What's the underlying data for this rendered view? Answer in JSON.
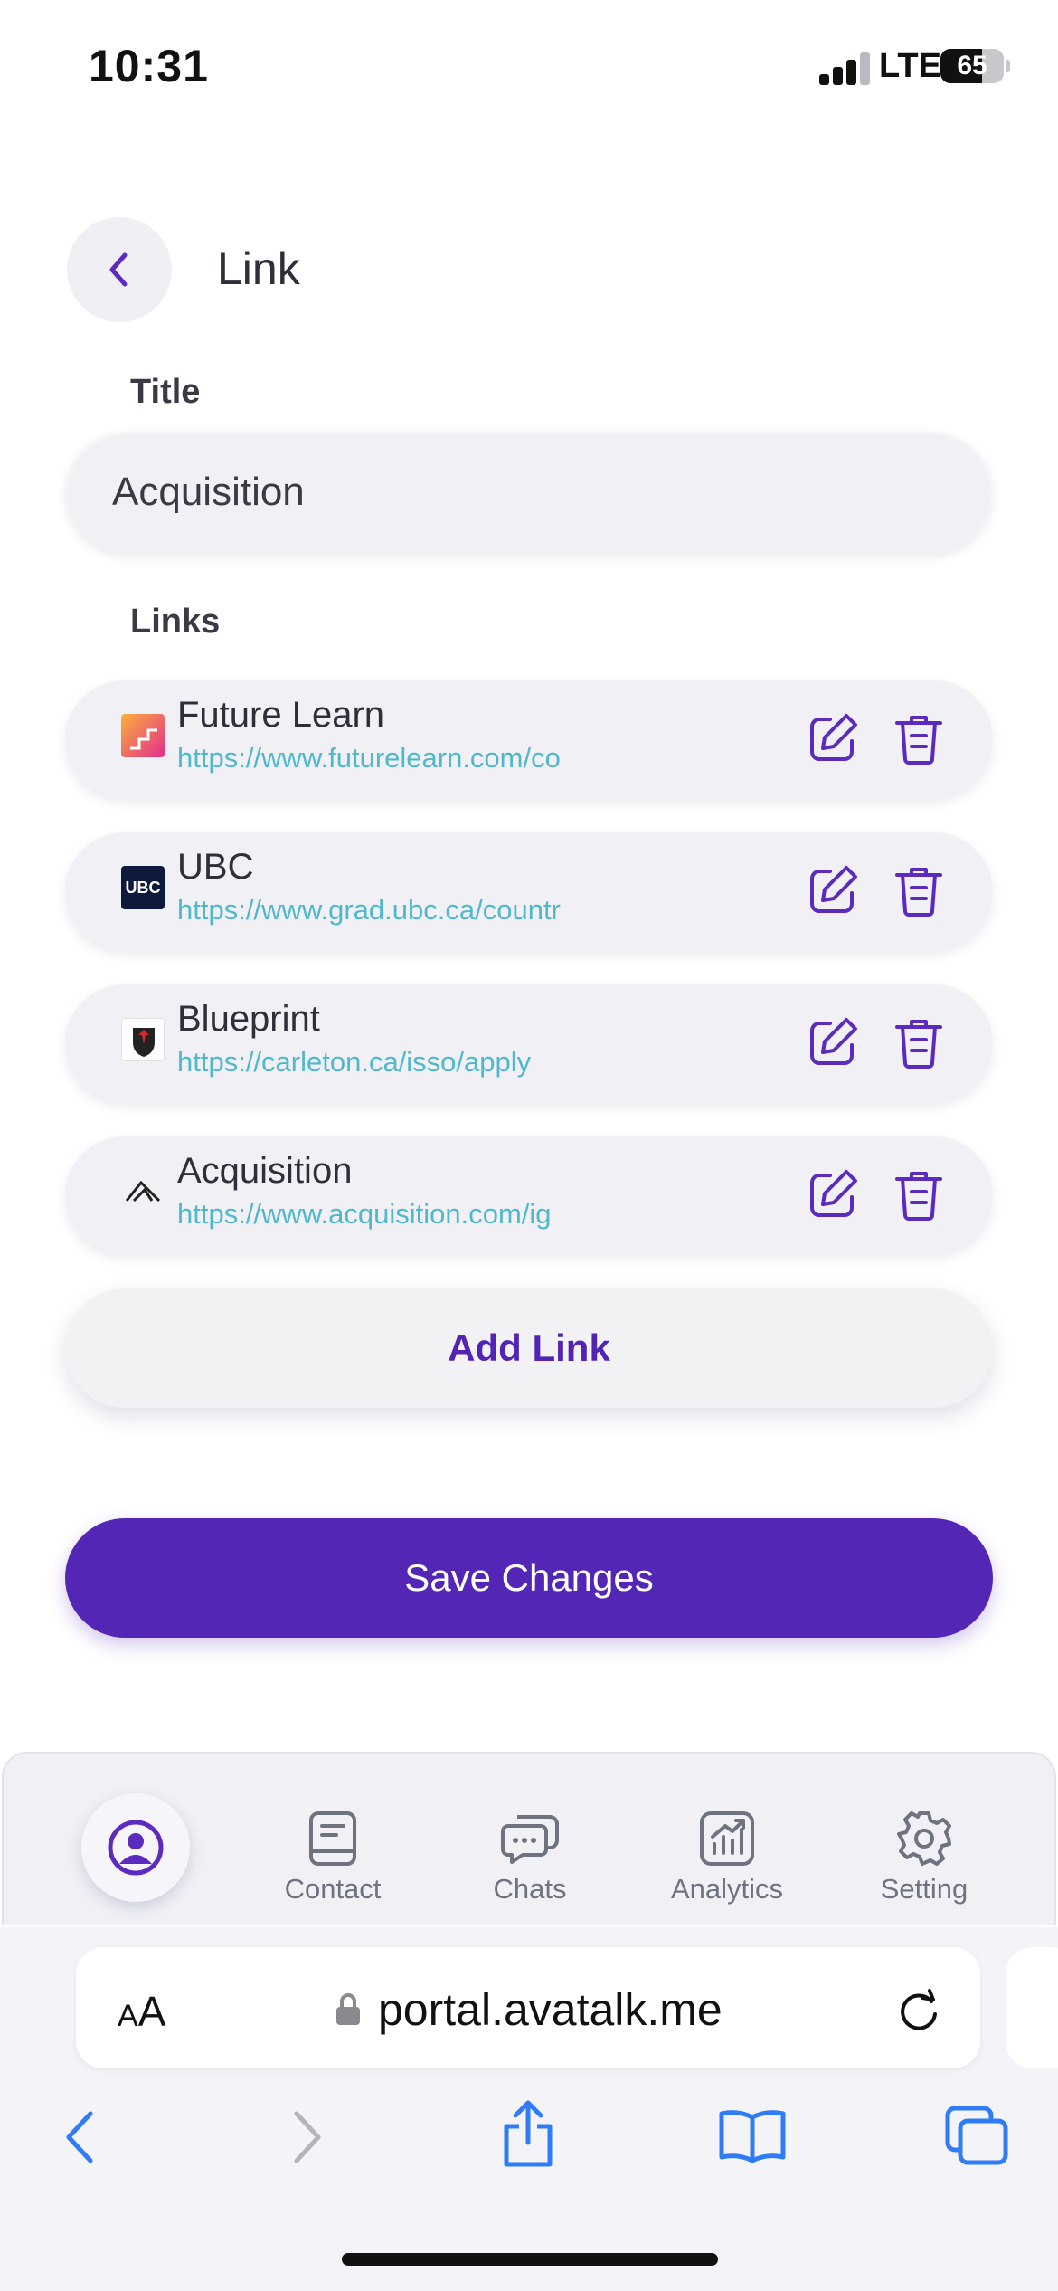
{
  "status_bar": {
    "time": "10:31",
    "network": "LTE",
    "battery": "65",
    "battery_level": 0.65
  },
  "header": {
    "title": "Link",
    "back_icon": "chevron-left-icon"
  },
  "form": {
    "title_label": "Title",
    "title_value": "Acquisition",
    "links_label": "Links",
    "links": [
      {
        "name": "Future Learn",
        "url": "https://www.futurelearn.com/co",
        "icon": "futurelearn-logo"
      },
      {
        "name": "UBC",
        "url": "https://www.grad.ubc.ca/countr",
        "icon": "ubc-logo",
        "icon_text": "UBC"
      },
      {
        "name": "Blueprint",
        "url": "https://carleton.ca/isso/apply",
        "icon": "carleton-logo"
      },
      {
        "name": "Acquisition",
        "url": "https://www.acquisition.com/ig",
        "icon": "acquisition-logo"
      }
    ],
    "add_link_label": "Add Link",
    "save_label": "Save Changes"
  },
  "app_nav": {
    "items": [
      {
        "label": "Contact",
        "icon": "contact-book-icon"
      },
      {
        "label": "Chats",
        "icon": "chat-bubbles-icon"
      },
      {
        "label": "Analytics",
        "icon": "analytics-chart-icon"
      },
      {
        "label": "Setting",
        "icon": "gear-icon"
      }
    ],
    "profile_icon": "user-circle-icon"
  },
  "browser": {
    "text_size_small": "A",
    "text_size_large": "A",
    "url": "portal.avatalk.me"
  },
  "colors": {
    "primary": "#5326b6",
    "link_url": "#4fb8cc",
    "icon_purple": "#5b2bbf",
    "safari_blue": "#2f7cf6"
  }
}
